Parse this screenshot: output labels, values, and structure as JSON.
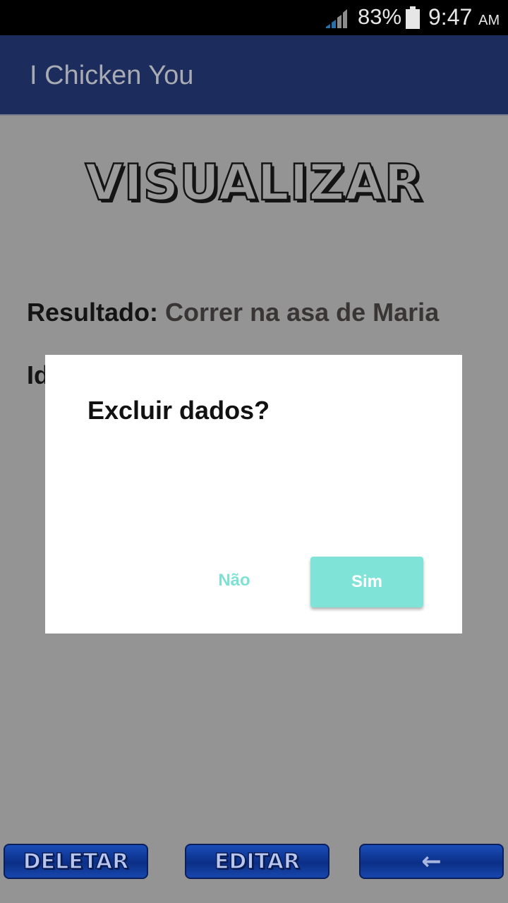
{
  "status_bar": {
    "battery_percent": "83%",
    "time": "9:47",
    "ampm": "AM",
    "signal_icon": "signal-icon",
    "battery_icon": "battery-icon"
  },
  "action_bar": {
    "title": "I Chicken You"
  },
  "page": {
    "heading": "VISUALIZAR",
    "fields": [
      {
        "label": "Resultado:",
        "value": "Correr na asa de Maria"
      },
      {
        "label": "Id",
        "value": ""
      }
    ]
  },
  "dialog": {
    "title": "Excluir dados?",
    "negative_label": "Não",
    "positive_label": "Sim"
  },
  "bottom_buttons": {
    "delete_label": "DELETAR",
    "edit_label": "EDITAR",
    "back_label": "←"
  },
  "colors": {
    "action_bar": "#1c2c5c",
    "dialog_accent": "#7fe3d8",
    "button_blue": "#0b2f86",
    "scrim_background": "#949494"
  }
}
